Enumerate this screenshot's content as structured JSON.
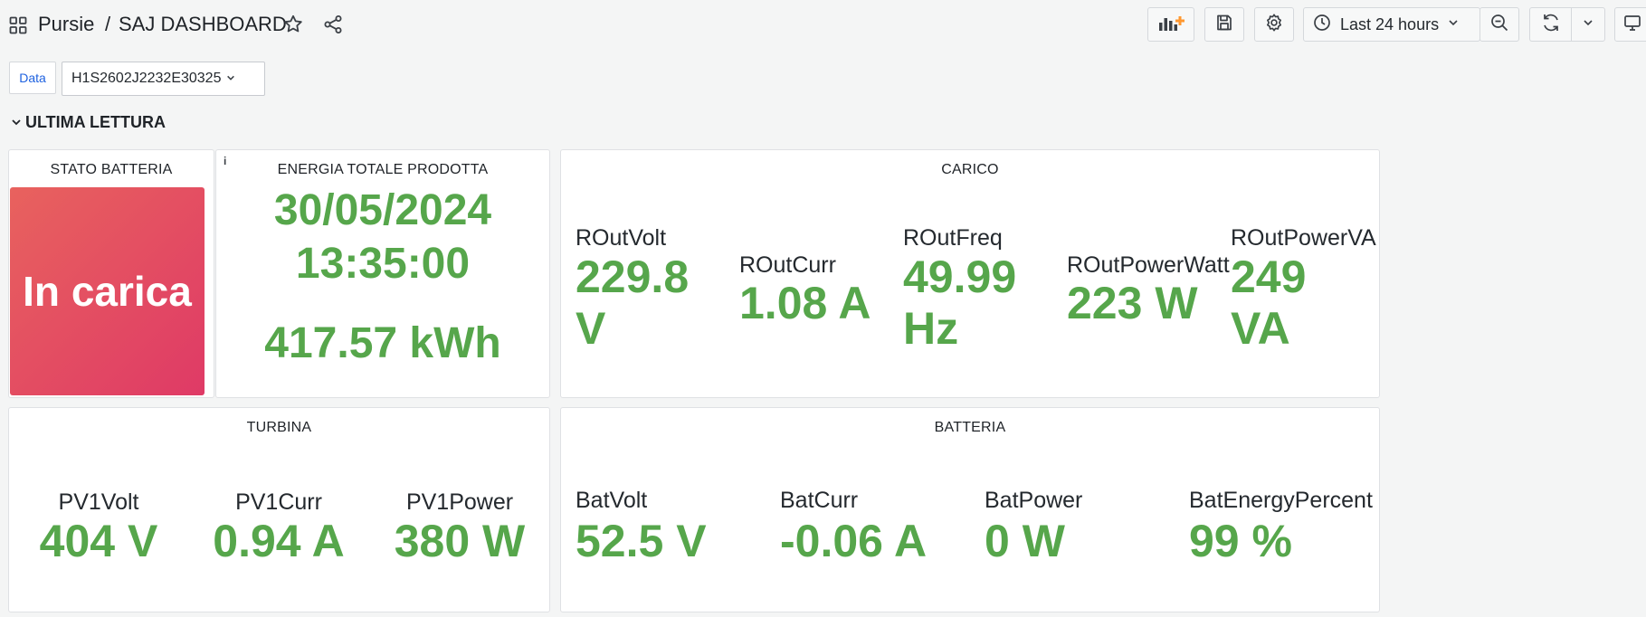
{
  "header": {
    "folder": "Pursie",
    "separator": "/",
    "dashboard_title": "SAJ DASHBOARD",
    "time_range": "Last 24 hours",
    "icons": [
      "apps-icon",
      "star-icon",
      "share-icon",
      "add-panel-icon",
      "save-icon",
      "gear-icon",
      "clock-icon",
      "chevron-down-icon",
      "zoom-out-icon",
      "refresh-icon",
      "tv-icon"
    ]
  },
  "variables": {
    "label": "Data",
    "selected": "H1S2602J2232E30325"
  },
  "row": {
    "title": "ULTIMA LETTURA"
  },
  "panels": {
    "stato_batteria": {
      "title": "STATO BATTERIA",
      "value": "In carica"
    },
    "energia": {
      "title": "ENERGIA TOTALE PRODOTTA",
      "date": "30/05/2024",
      "time": "13:35:00",
      "total": "417.57 kWh",
      "info": "i"
    },
    "carico": {
      "title": "CARICO",
      "stats": [
        {
          "name": "ROutVolt",
          "value_line1": "229.8",
          "value_line2": "V"
        },
        {
          "name": "ROutCurr",
          "value_line1": "1.08 A",
          "value_line2": ""
        },
        {
          "name": "ROutFreq",
          "value_line1": "49.99",
          "value_line2": "Hz"
        },
        {
          "name": "ROutPowerWatt",
          "value_line1": "223 W",
          "value_line2": ""
        },
        {
          "name": "ROutPowerVA",
          "value_line1": "249",
          "value_line2": "VA"
        }
      ]
    },
    "turbina": {
      "title": "TURBINA",
      "stats": [
        {
          "name": "PV1Volt",
          "value": "404 V"
        },
        {
          "name": "PV1Curr",
          "value": "0.94 A"
        },
        {
          "name": "PV1Power",
          "value": "380 W"
        }
      ]
    },
    "batteria": {
      "title": "BATTERIA",
      "stats": [
        {
          "name": "BatVolt",
          "value": "52.5 V"
        },
        {
          "name": "BatCurr",
          "value": "-0.06 A"
        },
        {
          "name": "BatPower",
          "value": "0 W"
        },
        {
          "name": "BatEnergyPercent",
          "value": "99 %"
        }
      ]
    }
  },
  "colors": {
    "value_green": "#56a64b",
    "battery_gradient_start": "#e8625e",
    "battery_gradient_end": "#df3a66",
    "link_blue": "#1f62e0",
    "add_panel_orange": "#ff9830"
  }
}
